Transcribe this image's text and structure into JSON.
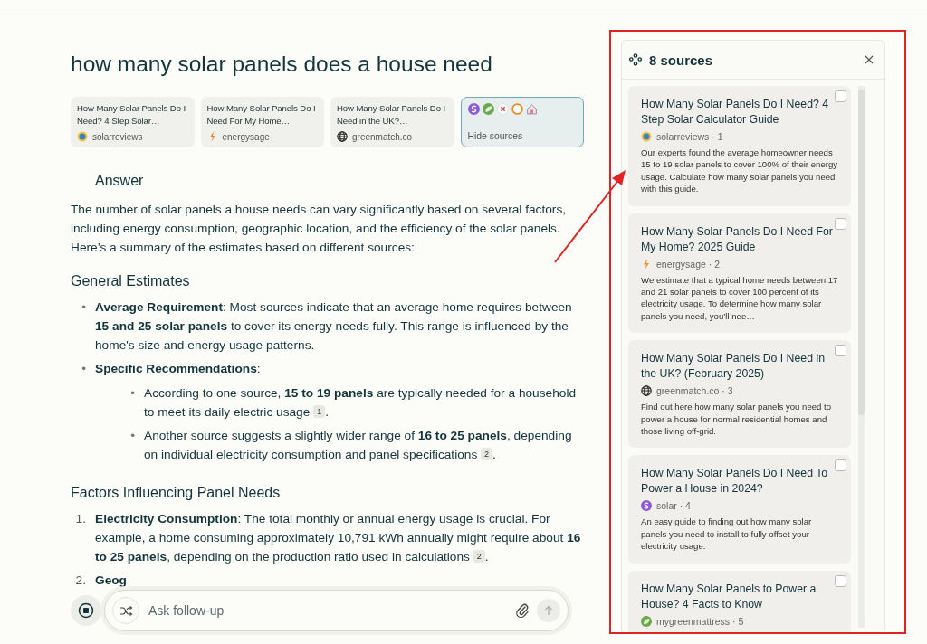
{
  "query": "how many solar panels does a house need",
  "source_chips": [
    {
      "title": "How Many Solar Panels Do I Need? 4 Step Solar…",
      "site": "solarreviews",
      "kind": "sun"
    },
    {
      "title": "How Many Solar Panels Do I Need For My Home…",
      "site": "energysage",
      "kind": "bolt"
    },
    {
      "title": "How Many Solar Panels Do I Need in the UK?…",
      "site": "greenmatch.co",
      "kind": "globe"
    }
  ],
  "hide_chip": {
    "label": "Hide sources",
    "icons": [
      {
        "kind": "s"
      },
      {
        "kind": "leaf"
      },
      {
        "kind": "cross"
      },
      {
        "kind": "ring"
      },
      {
        "kind": "house"
      }
    ]
  },
  "answer": {
    "heading": "Answer",
    "intro": "The number of solar panels a house needs can vary significantly based on several factors, including energy consumption, geographic location, and the efficiency of the solar panels. Here’s a summary of the estimates based on different sources:",
    "sections": [
      {
        "heading": "General Estimates",
        "kind": "bullets",
        "items": [
          {
            "marker": "•",
            "text": "**Average Requirement**: Most sources indicate that an average home requires between **15 and 25 solar panels** to cover its energy needs fully. This range is influenced by the home's size and energy usage patterns."
          },
          {
            "marker": "•",
            "text": "**Specific Recommendations**:",
            "children": [
              {
                "marker": "•",
                "text": "According to one source, **15 to 19 panels** are typically needed for a household to meet its daily electric usage",
                "citation": "1",
                "tail": "."
              },
              {
                "marker": "•",
                "text": "Another source suggests a slightly wider range of **16 to 25 panels**, depending on individual electricity consumption and panel specifications",
                "citation": "2",
                "tail": "."
              }
            ]
          }
        ]
      },
      {
        "heading": "Factors Influencing Panel Needs",
        "kind": "numbered",
        "items": [
          {
            "marker": "1.",
            "text": "**Electricity Consumption**: The total monthly or annual energy usage is crucial. For example, a home consuming approximately 10,791 kWh annually might require about **16 to 25 panels**, depending on the production ratio used in calculations",
            "citation": "2",
            "tail": "."
          },
          {
            "marker": "2.",
            "text": "**Geog**"
          }
        ]
      }
    ]
  },
  "follow_up": {
    "placeholder": "Ask follow-up"
  },
  "sources_panel": {
    "title": "8 sources",
    "sources": [
      {
        "title": "How Many Solar Panels Do I Need? 4 Step Solar Calculator Guide",
        "source": "solarreviews · 1",
        "kind": "sun",
        "checked": false,
        "description": "Our experts found the average homeowner needs 15 to 19 solar panels to cover 100% of their energy usage. Calculate how many solar panels you need with this guide."
      },
      {
        "title": "How Many Solar Panels Do I Need For My Home? 2025 Guide",
        "source": "energysage · 2",
        "kind": "bolt",
        "checked": false,
        "description": "We estimate that a typical home needs between 17 and 21 solar panels to cover 100 percent of its electricity usage. To determine how many solar panels you need, you’ll nee…"
      },
      {
        "title": "How Many Solar Panels Do I Need in the UK? (February 2025)",
        "source": "greenmatch.co · 3",
        "kind": "globe",
        "checked": false,
        "description": "Find out here how many solar panels you need to power a house for normal residential homes and those living off-grid."
      },
      {
        "title": "How Many Solar Panels Do I Need To Power a House in 2024?",
        "source": "solar · 4",
        "kind": "s",
        "checked": false,
        "description": "An easy guide to finding out how many solar panels you need to install to fully offset your electricity usage."
      },
      {
        "title": "How Many Solar Panels to Power a House? 4 Facts to Know",
        "source": "mygreenmattress · 5",
        "kind": "leaf",
        "checked": false
      }
    ]
  }
}
